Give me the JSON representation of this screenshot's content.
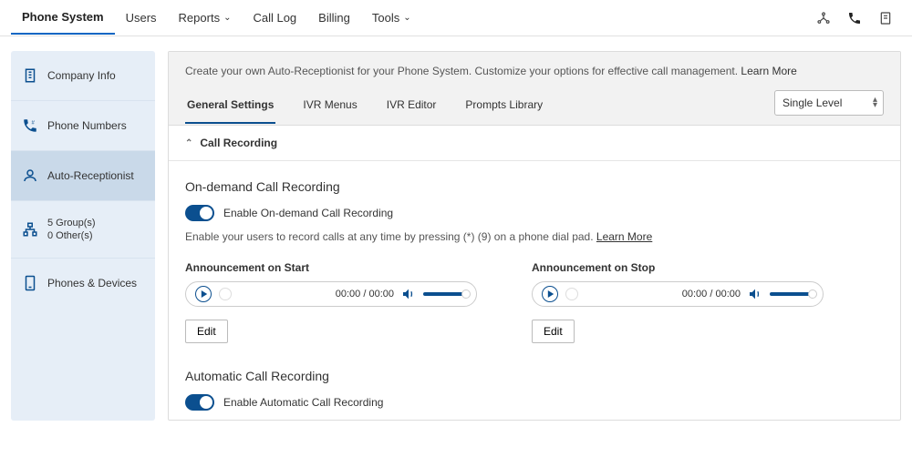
{
  "topnav": {
    "items": [
      {
        "label": "Phone System",
        "active": true
      },
      {
        "label": "Users"
      },
      {
        "label": "Reports",
        "dropdown": true
      },
      {
        "label": "Call Log"
      },
      {
        "label": "Billing"
      },
      {
        "label": "Tools",
        "dropdown": true
      }
    ]
  },
  "sidebar": {
    "items": [
      {
        "label": "Company Info"
      },
      {
        "label": "Phone Numbers"
      },
      {
        "label": "Auto-Receptionist",
        "active": true
      },
      {
        "line1": "5 Group(s)",
        "line2": "0 Other(s)"
      },
      {
        "label": "Phones & Devices"
      }
    ]
  },
  "header": {
    "desc_prefix": "Create your own Auto-Receptionist for your Phone System. Customize your options for effective call management. ",
    "learn_more": "Learn More",
    "tabs": [
      {
        "label": "General Settings",
        "active": true
      },
      {
        "label": "IVR Menus"
      },
      {
        "label": "IVR Editor"
      },
      {
        "label": "Prompts Library"
      }
    ],
    "level": "Single Level"
  },
  "section": {
    "title": "Call Recording",
    "ondemand_heading": "On-demand Call Recording",
    "ondemand_toggle_label": "Enable On-demand Call Recording",
    "ondemand_desc_prefix": "Enable your users to record calls at any time by pressing (*) (9) on a phone dial pad. ",
    "learn_more": "Learn More",
    "start_label": "Announcement on Start",
    "stop_label": "Announcement on Stop",
    "time_display": "00:00 / 00:00",
    "edit_label": "Edit",
    "auto_heading": "Automatic Call Recording",
    "auto_toggle_label": "Enable Automatic Call Recording"
  }
}
